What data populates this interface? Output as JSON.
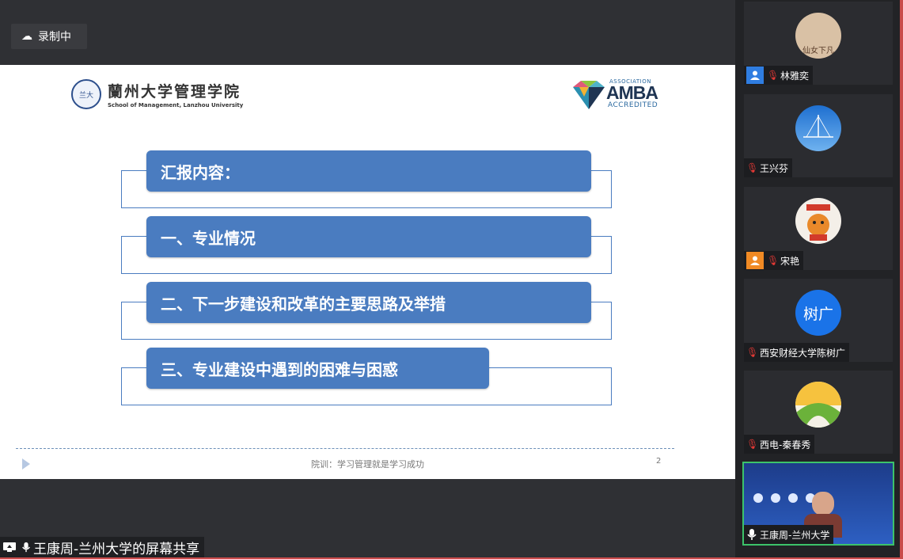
{
  "recording": {
    "label": "录制中"
  },
  "slide": {
    "school_logo_cn": "蘭州大学管理学院",
    "school_logo_en": "School of Management, Lanzhou University",
    "amba_logo": {
      "association": "ASSOCIATION",
      "name": "AMBA",
      "accredited": "ACCREDITED"
    },
    "agenda": [
      {
        "label": "汇报内容："
      },
      {
        "label": "一、专业情况"
      },
      {
        "label": "二、下一步建设和改革的主要思路及举措"
      },
      {
        "label": "三、专业建设中遇到的困难与困惑"
      }
    ],
    "footer_text": "院训：学习管理就是学习成功",
    "page_number": "2",
    "accent_color": "#4a7cc0"
  },
  "screen_share": {
    "label": "王康周-兰州大学的屏幕共享"
  },
  "participants": [
    {
      "name": "林雅奕",
      "avatar_text": "仙女下凡",
      "host_icon": "user-icon",
      "muted": true
    },
    {
      "name": "王兴芬",
      "avatar_text": "",
      "host_icon": "",
      "muted": true
    },
    {
      "name": "宋艳",
      "avatar_text": "",
      "host_icon": "user-icon",
      "muted": true
    },
    {
      "name": "西安财经大学陈树广",
      "avatar_text": "树广",
      "host_icon": "",
      "muted": true
    },
    {
      "name": "西电-秦春秀",
      "avatar_text": "",
      "host_icon": "",
      "muted": true
    },
    {
      "name": "王康周-兰州大学",
      "avatar_text": "",
      "host_icon": "",
      "muted": false,
      "active_speaker": true
    }
  ]
}
